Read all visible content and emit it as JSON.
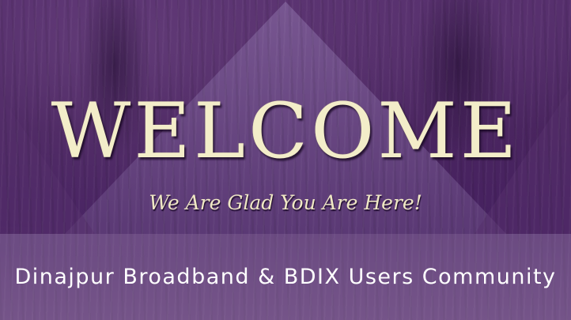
{
  "banner": {
    "headline": "WELCOME",
    "tagline": "We Are Glad You Are Here!",
    "community_name": "Dinajpur Broadband & BDIX Users Community"
  },
  "colors": {
    "background": "#3f1b55",
    "diamond": "#6a4a85",
    "headline": "#f3edc9",
    "band": "#a48ab4",
    "band_text": "#ffffff"
  }
}
